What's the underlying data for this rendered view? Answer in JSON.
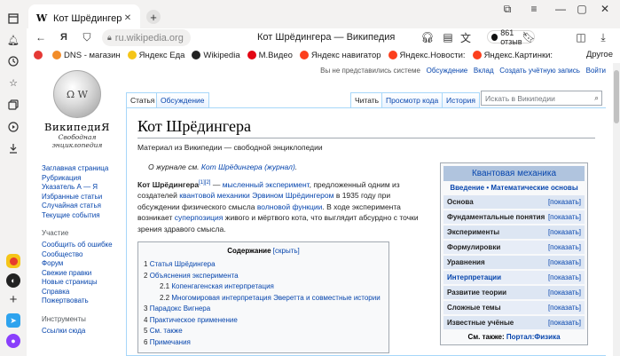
{
  "browser": {
    "tab_title": "Кот Шрёдингера — Википедия",
    "tab_favicon": "W",
    "new_tab_symbol": "+",
    "url": "ru.wikipedia.org",
    "page_title": "Кот Шрёдингера — Википедия",
    "reviews": "861 отзыв",
    "bookmarks": [
      {
        "label": "DNS - магазин",
        "color": "#f28c28"
      },
      {
        "label": "Яндекс Еда",
        "color": "#f5c518"
      },
      {
        "label": "Wikipedia",
        "color": "#222222"
      },
      {
        "label": "М.Видео",
        "color": "#e30613"
      },
      {
        "label": "Яндекс навигатор",
        "color": "#fc3f1d"
      },
      {
        "label": "Яндекс.Новости:",
        "color": "#fc3f1d"
      },
      {
        "label": "Яндекс.Картинки:",
        "color": "#fc3f1d"
      }
    ],
    "bookmarks_other": "Другое"
  },
  "wiki": {
    "personal": {
      "not_logged_in": "Вы не представились системе",
      "talk": "Обсуждение",
      "contributions": "Вклад",
      "create_account": "Создать учётную запись",
      "login": "Войти"
    },
    "logo_name": "ВикипедиЯ",
    "logo_tagline": "Свободная энциклопедия",
    "nav_main": [
      "Заглавная страница",
      "Рубрикация",
      "Указатель А — Я",
      "Избранные статьи",
      "Случайная статья",
      "Текущие события"
    ],
    "nav_section_title": "Участие",
    "nav_participation": [
      "Сообщить об ошибке",
      "Сообщество",
      "Форум",
      "Свежие правки",
      "Новые страницы",
      "Справка",
      "Пожертвовать"
    ],
    "nav_section2_title": "Инструменты",
    "nav_tools": [
      "Ссылки сюда"
    ],
    "tabs": {
      "article": "Статья",
      "talk": "Обсуждение",
      "read": "Читать",
      "view_source": "Просмотр кода",
      "history": "История"
    },
    "search_placeholder": "Искать в Википедии",
    "title": "Кот Шрёдингера",
    "from": "Материал из Википедии — свободной энциклопедии",
    "hatnote_prefix": "О журнале см.",
    "hatnote_link": "Кот Шрёдингера (журнал)",
    "hatnote_suffix": ".",
    "lead": {
      "bold": "Кот Шрёдингера",
      "refs": "[1][2]",
      "t1": " — ",
      "l1": "мысленный эксперимент",
      "t2": ", предложенный одним из создателей ",
      "l2": "квантовой механики",
      "t3": " ",
      "l3": "Эрвином Шрёдингером",
      "t4": " в 1935 году при обсуждении физического смысла ",
      "l4": "волновой функции",
      "t5": ". В ходе эксперимента возникает ",
      "l5": "суперпозиция",
      "t6": " живого и мёртвого кота, что выглядит абсурдно с точки зрения здравого смысла."
    },
    "toc": {
      "title": "Содержание",
      "hide": "[скрыть]",
      "items": [
        {
          "num": "1",
          "text": "Статья Шрёдингера",
          "level": 1
        },
        {
          "num": "2",
          "text": "Объяснения эксперимента",
          "level": 1
        },
        {
          "num": "2.1",
          "text": "Копенгагенская интерпретация",
          "level": 2
        },
        {
          "num": "2.2",
          "text": "Многомировая интерпретация Эверетта и совместные истории",
          "level": 2
        },
        {
          "num": "3",
          "text": "Парадокс Вигнера",
          "level": 1
        },
        {
          "num": "4",
          "text": "Практическое применение",
          "level": 1
        },
        {
          "num": "5",
          "text": "См. также",
          "level": 1
        },
        {
          "num": "6",
          "text": "Примечания",
          "level": 1
        }
      ]
    },
    "infobox": {
      "title": "Квантовая механика",
      "intro": "Введение",
      "sep": " • ",
      "basics": "Математические основы",
      "show": "[показать]",
      "rows": [
        "Основа",
        "Фундаментальные понятия",
        "Эксперименты",
        "Формулировки",
        "Уравнения",
        "Интерпретации",
        "Развитие теории",
        "Сложные темы",
        "Известные учёные"
      ],
      "footer_prefix": "См. также: ",
      "footer_link": "Портал:Физика"
    }
  }
}
